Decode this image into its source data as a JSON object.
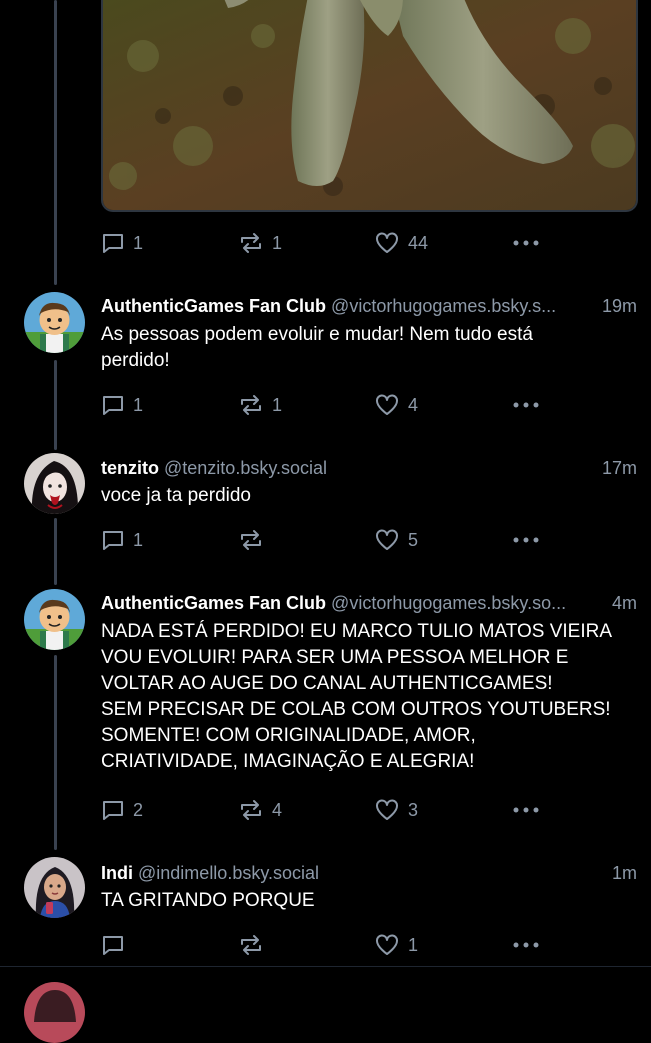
{
  "top_post": {
    "actions": {
      "reply": "1",
      "repost": "1",
      "like": "44"
    }
  },
  "posts": [
    {
      "name": "AuthenticGames Fan Club",
      "handle": "@victorhugogames.bsky.s...",
      "time": "19m",
      "lines": [
        "As pessoas podem evoluir e mudar! Nem tudo está",
        "perdido!"
      ],
      "actions": {
        "reply": "1",
        "repost": "1",
        "like": "4"
      }
    },
    {
      "name": "tenzito",
      "handle": "@tenzito.bsky.social",
      "time": "17m",
      "lines": [
        "voce ja ta perdido"
      ],
      "actions": {
        "reply": "1",
        "repost": "",
        "like": "5"
      }
    },
    {
      "name": "AuthenticGames Fan Club",
      "handle": "@victorhugogames.bsky.so...",
      "time": "4m",
      "lines": [
        "NADA ESTÁ PERDIDO! EU MARCO TULIO MATOS VIEIRA",
        "VOU EVOLUIR! PARA SER UMA PESSOA MELHOR E",
        "VOLTAR AO AUGE DO CANAL AUTHENTICGAMES!",
        "SEM PRECISAR DE COLAB COM OUTROS YOUTUBERS!",
        "SOMENTE!  COM ORIGINALIDADE, AMOR,",
        "CRIATIVIDADE, IMAGINAÇÃO E ALEGRIA!"
      ],
      "actions": {
        "reply": "2",
        "repost": "4",
        "like": "3"
      }
    },
    {
      "name": "Indi",
      "handle": "@indimello.bsky.social",
      "time": "1m",
      "lines": [
        "TA GRITANDO PORQUE"
      ],
      "actions": {
        "reply": "",
        "repost": "",
        "like": "1"
      }
    }
  ],
  "colors": {
    "background": "#000000",
    "muted": "#8d99a8",
    "thread_line": "#3a4250"
  }
}
